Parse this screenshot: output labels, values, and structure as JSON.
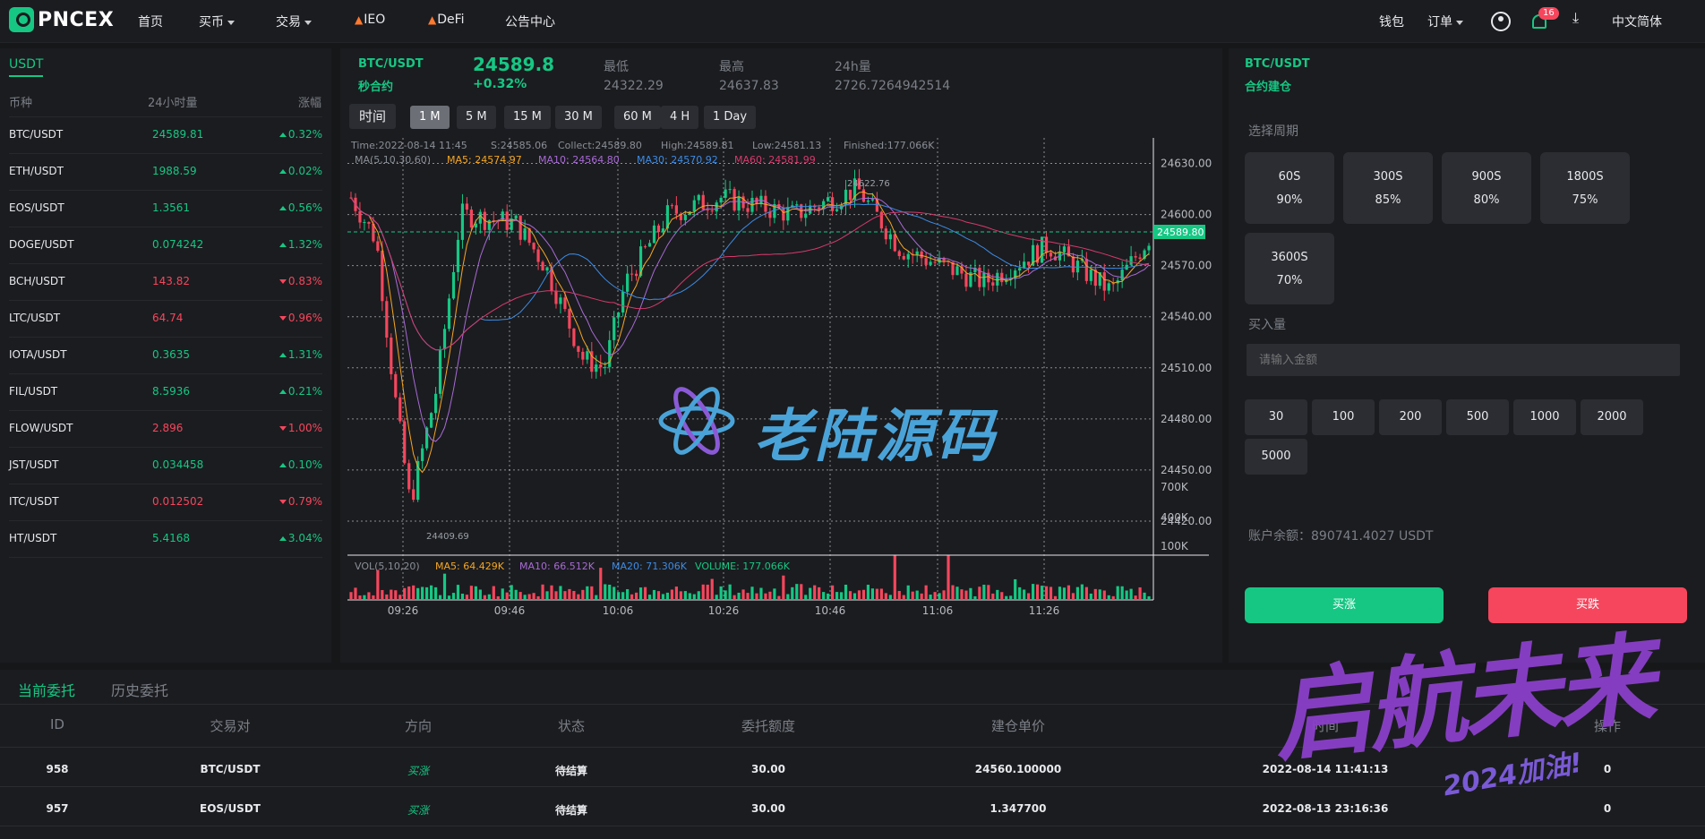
{
  "brand": {
    "name": "PNCEX"
  },
  "nav": {
    "home": "首页",
    "buy": "买币",
    "trade": "交易",
    "ieo": "IEO",
    "defi": "DeFi",
    "notice": "公告中心",
    "wallet": "钱包",
    "orders": "订单",
    "notif_count": "16",
    "language": "中文简体"
  },
  "markets": {
    "tab": "USDT",
    "headers": {
      "symbol": "币种",
      "volume": "24小时量",
      "change": "涨幅"
    },
    "rows": [
      {
        "symbol": "BTC/USDT",
        "price": "24589.81",
        "change": "0.32%",
        "dir": "up"
      },
      {
        "symbol": "ETH/USDT",
        "price": "1988.59",
        "change": "0.02%",
        "dir": "up"
      },
      {
        "symbol": "EOS/USDT",
        "price": "1.3561",
        "change": "0.56%",
        "dir": "up"
      },
      {
        "symbol": "DOGE/USDT",
        "price": "0.074242",
        "change": "1.32%",
        "dir": "up"
      },
      {
        "symbol": "BCH/USDT",
        "price": "143.82",
        "change": "0.83%",
        "dir": "down"
      },
      {
        "symbol": "LTC/USDT",
        "price": "64.74",
        "change": "0.96%",
        "dir": "down"
      },
      {
        "symbol": "IOTA/USDT",
        "price": "0.3635",
        "change": "1.31%",
        "dir": "up"
      },
      {
        "symbol": "FIL/USDT",
        "price": "8.5936",
        "change": "0.21%",
        "dir": "up"
      },
      {
        "symbol": "FLOW/USDT",
        "price": "2.896",
        "change": "1.00%",
        "dir": "down"
      },
      {
        "symbol": "JST/USDT",
        "price": "0.034458",
        "change": "0.10%",
        "dir": "up"
      },
      {
        "symbol": "ITC/USDT",
        "price": "0.012502",
        "change": "0.79%",
        "dir": "down"
      },
      {
        "symbol": "HT/USDT",
        "price": "5.4168",
        "change": "3.04%",
        "dir": "up"
      }
    ]
  },
  "ticker": {
    "pair": "BTC/USDT",
    "mode": "秒合约",
    "price": "24589.8",
    "change": "+0.32%",
    "low_label": "最低",
    "low": "24322.29",
    "high_label": "最高",
    "high": "24637.83",
    "vol_label": "24h量",
    "vol": "2726.7264942514"
  },
  "periods": {
    "time": "时间",
    "items": [
      "1 M",
      "5 M",
      "15 M",
      "30 M",
      "60 M",
      "4 H",
      "1 Day"
    ],
    "active": "1 M"
  },
  "chart_info": {
    "time": "Time:2022-08-14 11:45",
    "s": "S:24585.06",
    "collect": "Collect:24589.80",
    "high": "High:24589.81",
    "low": "Low:24581.13",
    "finished": "Finished:177.066K",
    "ma_label": "MA(5,10,30,60)",
    "ma5": "MA5: 24574.97",
    "ma10": "MA10: 24564.80",
    "ma30": "MA30: 24570.92",
    "ma60": "MA60: 24581.99",
    "vol_label": "VOL(5,10,20)",
    "vma5": "MA5: 64.429K",
    "vma10": "MA10: 66.512K",
    "vma20": "MA20: 71.306K",
    "volume": "VOLUME: 177.066K",
    "max_mark": "24622.76",
    "min_mark": "24409.69",
    "last_price": "24589.80"
  },
  "chart_data": {
    "type": "candlestick",
    "title": "BTC/USDT",
    "y_ticks": [
      "24630.00",
      "24600.00",
      "24570.00",
      "24540.00",
      "24510.00",
      "24480.00",
      "24450.00",
      "24420.00"
    ],
    "vol_ticks": [
      "700K",
      "400K",
      "100K"
    ],
    "x_ticks": [
      "09:26",
      "09:46",
      "10:06",
      "10:26",
      "10:46",
      "11:06",
      "11:26"
    ],
    "ylim": [
      24400,
      24645
    ],
    "colors": {
      "up": "#16c784",
      "down": "#f6465d",
      "ma5": "#f5a623",
      "ma10": "#a86ad6",
      "ma30": "#3c8be6",
      "ma60": "#d63a6c"
    }
  },
  "order_panel": {
    "pair": "BTC/USDT",
    "mode": "合约建仓",
    "cycle_label": "选择周期",
    "cycles": [
      {
        "period": "60S",
        "rate": "90%"
      },
      {
        "period": "300S",
        "rate": "85%"
      },
      {
        "period": "900S",
        "rate": "80%"
      },
      {
        "period": "1800S",
        "rate": "75%"
      },
      {
        "period": "3600S",
        "rate": "70%"
      }
    ],
    "amount_label": "买入量",
    "amount_placeholder": "请输入金额",
    "amounts": [
      "30",
      "100",
      "200",
      "500",
      "1000",
      "2000",
      "5000"
    ],
    "balance": "账户余额：890741.4027 USDT",
    "buy_up": "买涨",
    "buy_down": "买跌"
  },
  "orders": {
    "tabs": [
      "当前委托",
      "历史委托"
    ],
    "headers": [
      "ID",
      "交易对",
      "方向",
      "状态",
      "委托额度",
      "建仓单价",
      "时间",
      "操作"
    ],
    "rows": [
      {
        "id": "958",
        "pair": "BTC/USDT",
        "dir": "买涨",
        "status": "待结算",
        "amount": "30.00",
        "price": "24560.100000",
        "time": "2022-08-14 11:41:13",
        "op": "0"
      },
      {
        "id": "957",
        "pair": "EOS/USDT",
        "dir": "买涨",
        "status": "待结算",
        "amount": "30.00",
        "price": "1.347700",
        "time": "2022-08-13 23:16:36",
        "op": "0"
      }
    ]
  },
  "watermarks": {
    "center": "老陆源码",
    "corner": "启航未来",
    "corner_sub": "2024加油!"
  }
}
